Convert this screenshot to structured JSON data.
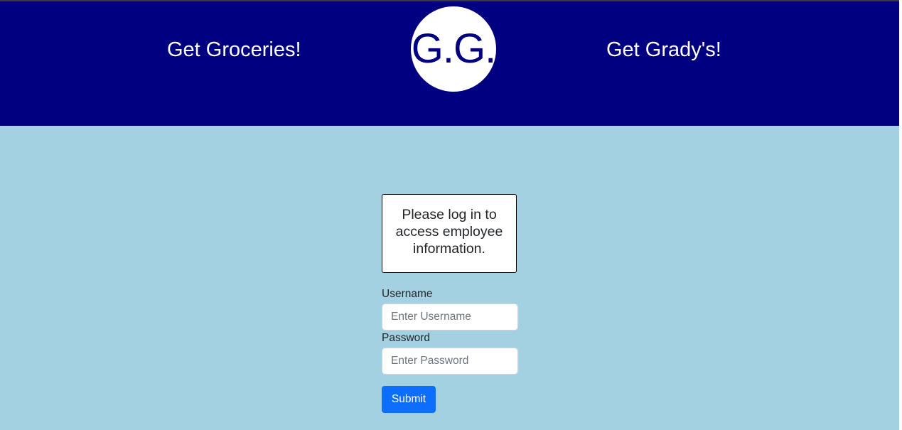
{
  "header": {
    "left_text": "Get Groceries!",
    "logo_text": "G.G.",
    "right_text": "Get Grady's!",
    "background_color": "#000080",
    "logo_text_color": "#000080"
  },
  "main": {
    "background_color": "#a3d1e2",
    "notice": "Please log in to access employee information.",
    "form": {
      "username_label": "Username",
      "username_placeholder": "Enter Username",
      "username_value": "",
      "password_label": "Password",
      "password_placeholder": "Enter Password",
      "password_value": "",
      "submit_label": "Submit",
      "submit_color": "#0d6efd"
    }
  }
}
